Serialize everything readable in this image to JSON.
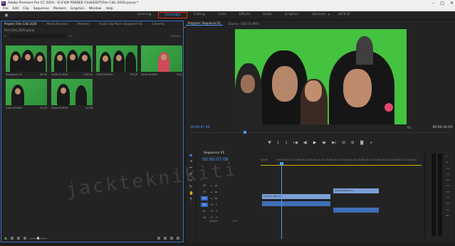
{
  "window": {
    "title": "Adobe Premiere Pro CC 2019 - D:\\FILM PENDEK CILIK\\EDIT\\Film Cilik 2020.prproj *"
  },
  "menu": [
    "File",
    "Edit",
    "Clip",
    "Sequence",
    "Markers",
    "Graphics",
    "Window",
    "Help"
  ],
  "workspaces": {
    "tabs": [
      "Learning",
      "Assembly",
      "Editing",
      "Color",
      "Effects",
      "Audio",
      "Graphics",
      "Libraries",
      "JACK ID"
    ],
    "active_index": 1,
    "more": "»"
  },
  "project": {
    "tabs": [
      "Project: Film Cilik 2020",
      "Media Browser",
      "Markers",
      "Audio Clip Mixer: Sequence 01",
      "Libraries"
    ],
    "bin": "Film Cilik 2020.prproj",
    "item_count": "8 Items",
    "clips": [
      {
        "name": "Sequence 01",
        "dur": "59:29"
      },
      {
        "name": "CILIK 01.MOV",
        "dur": "1:00:29"
      },
      {
        "name": "CILIK 02.MOV",
        "dur": "59:29"
      },
      {
        "name": "CILIK 04.MOV",
        "dur": "9:10"
      },
      {
        "name": "CILIK 03.MOV",
        "dur": "12:05"
      },
      {
        "name": "CILIK 05.MOV",
        "dur": "14:06"
      }
    ]
  },
  "source_tab": "Source: CILIK 01.MOV",
  "program": {
    "tab": "Program: Sequence 01",
    "timecode": "00:00:07:09",
    "fit": "Fit",
    "duration": "00:00:34:19"
  },
  "timeline": {
    "tab": "Sequence 01",
    "timecode": "00:00:07:09",
    "ruler": [
      "00:00",
      "00:00:04:23",
      "00:00:09:23",
      "00:00:14:23",
      "00:00:19:23",
      "00:00:24:23",
      "00:00:29:23",
      "00:00:34:23",
      "00:00:39:23",
      "00:00:44"
    ],
    "tracks": [
      "V3",
      "V2",
      "V1",
      "A1",
      "A2",
      "A3"
    ],
    "clip_v1": "CILIK 01.MOV [V]",
    "clip_v2": "CILIK 05.MOV [V]",
    "master": {
      "label": "Master",
      "value": "0.0"
    }
  },
  "meter": {
    "scale": [
      "0",
      "-6",
      "-12",
      "-18",
      "-24",
      "-30",
      "-36",
      "-42",
      "-48",
      "-54",
      "dB"
    ]
  },
  "watermark": "jackteknikiti"
}
